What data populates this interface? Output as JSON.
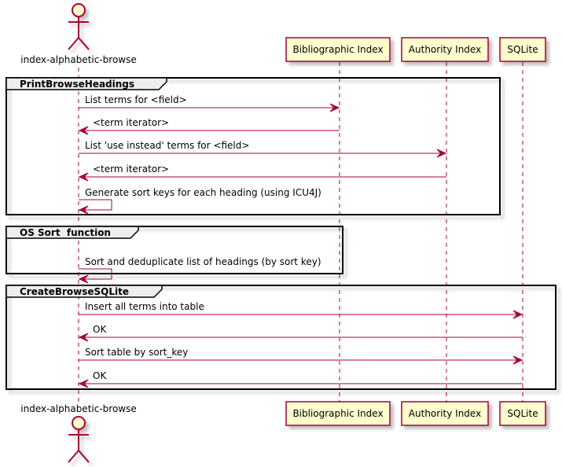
{
  "participants": [
    {
      "id": "actor",
      "label": "index-alphabetic-browse",
      "kind": "actor"
    },
    {
      "id": "bib",
      "label": "Bibliographic Index",
      "kind": "participant"
    },
    {
      "id": "auth",
      "label": "Authority Index",
      "kind": "participant"
    },
    {
      "id": "sqlite",
      "label": "SQLite",
      "kind": "participant"
    }
  ],
  "frames": [
    {
      "title": "PrintBrowseHeadings"
    },
    {
      "title": "OS Sort  function"
    },
    {
      "title": "CreateBrowseSQLite"
    }
  ],
  "messages": [
    {
      "from": "actor",
      "to": "bib",
      "label": "List terms for <field>",
      "type": "sync"
    },
    {
      "from": "bib",
      "to": "actor",
      "label": "<term iterator>",
      "type": "sync"
    },
    {
      "from": "actor",
      "to": "auth",
      "label": "List 'use instead' terms for <field>",
      "type": "sync"
    },
    {
      "from": "auth",
      "to": "actor",
      "label": "<term iterator>",
      "type": "sync"
    },
    {
      "from": "actor",
      "to": "actor",
      "label": "Generate sort keys for each heading (using ICU4J)",
      "type": "self"
    },
    {
      "from": "actor",
      "to": "actor",
      "label": "Sort and deduplicate list of headings (by sort key)",
      "type": "self"
    },
    {
      "from": "actor",
      "to": "sqlite",
      "label": "Insert all terms into table",
      "type": "sync"
    },
    {
      "from": "sqlite",
      "to": "actor",
      "label": "OK",
      "type": "sync"
    },
    {
      "from": "actor",
      "to": "sqlite",
      "label": "Sort table by sort_key",
      "type": "sync"
    },
    {
      "from": "sqlite",
      "to": "actor",
      "label": "OK",
      "type": "sync"
    }
  ],
  "colors": {
    "line": "#A80036",
    "participant_fill": "#FEFECE",
    "frame_header_fill": "#EEEEEE",
    "frame_border": "#000000",
    "shadow": "#C8C8C8"
  }
}
